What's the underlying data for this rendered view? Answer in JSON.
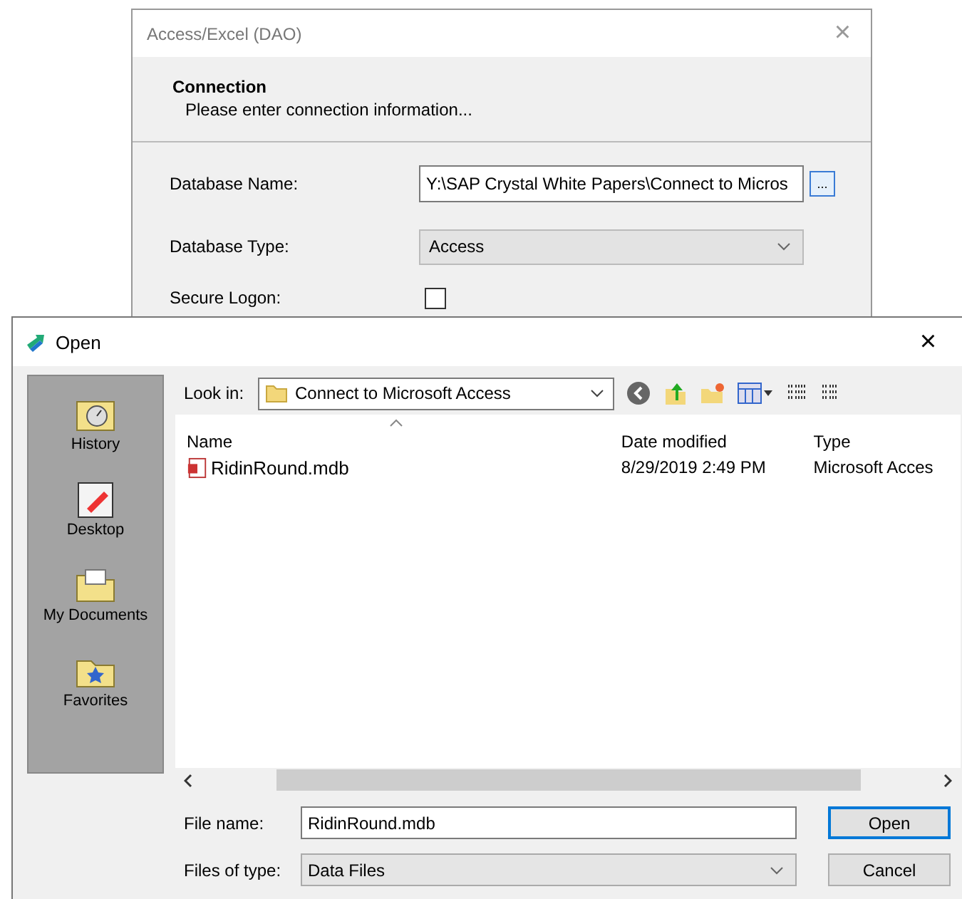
{
  "back_dialog": {
    "title": "Access/Excel (DAO)",
    "close": "×",
    "header": {
      "title": "Connection",
      "subtitle": "Please enter connection information..."
    },
    "fields": [
      {
        "kind": "text",
        "label": "Database Name:",
        "value": "Y:\\SAP Crystal White Papers\\Connect to Micros",
        "browse": "..."
      },
      {
        "kind": "dropdown",
        "label": "Database Type:",
        "value": "Access"
      },
      {
        "kind": "checkbox",
        "label": "Secure Logon:",
        "checked": false
      }
    ]
  },
  "open_dialog": {
    "title": "Open",
    "close": "×",
    "places": [
      {
        "label": "History",
        "kind": "history"
      },
      {
        "label": "Desktop",
        "kind": "desktop"
      },
      {
        "label": "My Documents",
        "kind": "documents"
      },
      {
        "label": "Favorites",
        "kind": "favorites"
      }
    ],
    "look_in": {
      "label": "Look in:",
      "value": "Connect to Microsoft Access"
    },
    "columns": [
      "Name",
      "Date modified",
      "Type"
    ],
    "rows": [
      {
        "name": "RidinRound.mdb",
        "date": "8/29/2019 2:49 PM",
        "type": "Microsoft Acces",
        "selected": false
      }
    ],
    "file_name": {
      "label": "File name:",
      "value": "RidinRound.mdb"
    },
    "file_type": {
      "label": "Files of type:",
      "value": "Data Files"
    },
    "buttons": [
      "Open",
      "Cancel"
    ]
  }
}
